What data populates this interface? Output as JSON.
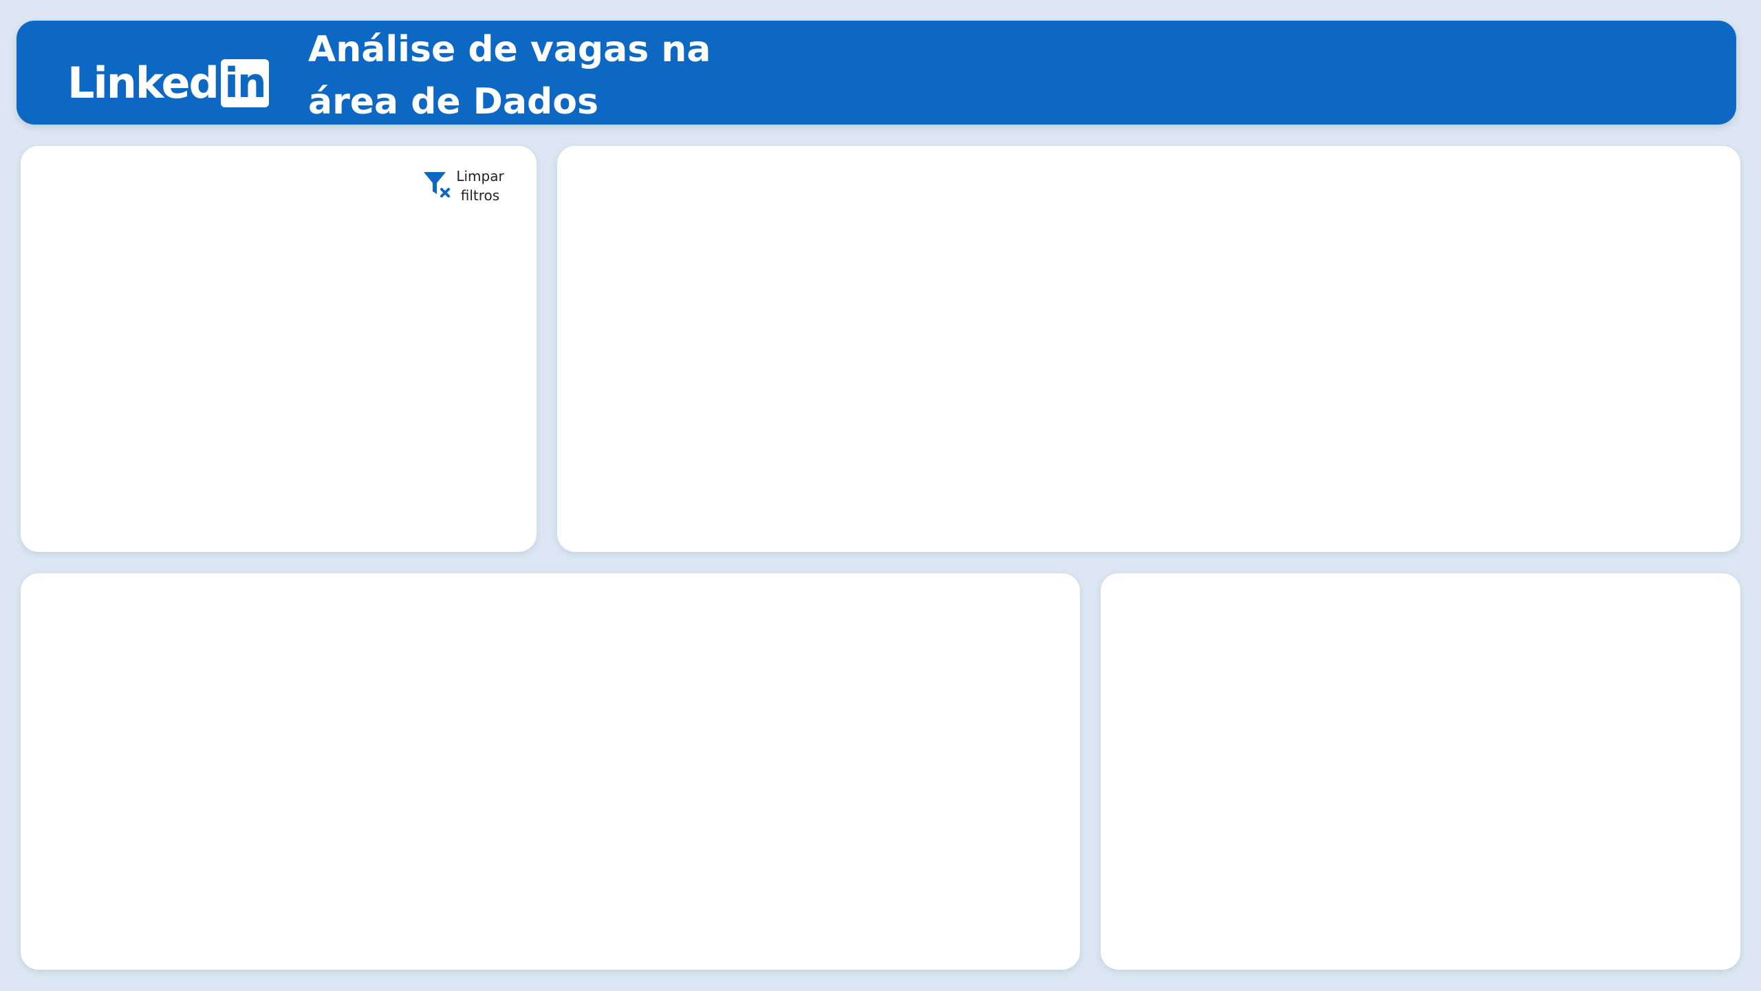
{
  "header": {
    "logo_text": "Linked",
    "logo_box_text": "in",
    "title": "Análise de vagas na área de Dados"
  },
  "filters": {
    "clear_label": "Limpar filtros"
  },
  "colors": {
    "brand": "#0d68c4",
    "background": "#dce7f3",
    "card": "#ffffff"
  },
  "icons": {
    "clear_filters": "filter-clear-icon"
  }
}
